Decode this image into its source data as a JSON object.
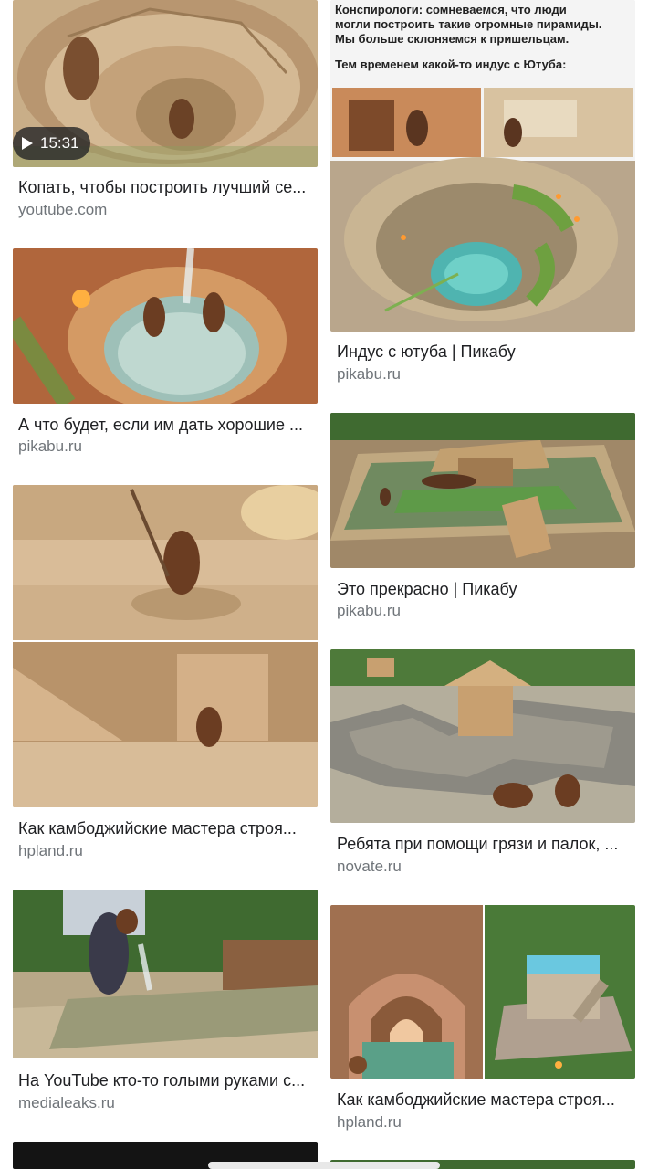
{
  "results": [
    {
      "title": "Копать, чтобы построить лучший се...",
      "source": "youtube.com",
      "duration": "15:31"
    },
    {
      "title": "Индус с ютуба | Пикабу",
      "source": "pikabu.ru",
      "meme_lines": [
        "Конспирологи: сомневаемся, что люди",
        "могли построить такие огромные пирамиды.",
        "Мы больше склоняемся к пришельцам.",
        "Тем временем какой-то индус с Ютуба:"
      ]
    },
    {
      "title": "А что будет, если им дать хорошие ...",
      "source": "pikabu.ru"
    },
    {
      "title": "Это прекрасно | Пикабу",
      "source": "pikabu.ru"
    },
    {
      "title": "Как камбоджийские мастера строя...",
      "source": "hpland.ru"
    },
    {
      "title": "Ребята при помощи грязи и палок, ...",
      "source": "novate.ru"
    },
    {
      "title": "На YouTube кто-то голыми руками с...",
      "source": "medialeaks.ru"
    },
    {
      "title": "Как камбоджийские мастера строя...",
      "source": "hpland.ru"
    }
  ]
}
